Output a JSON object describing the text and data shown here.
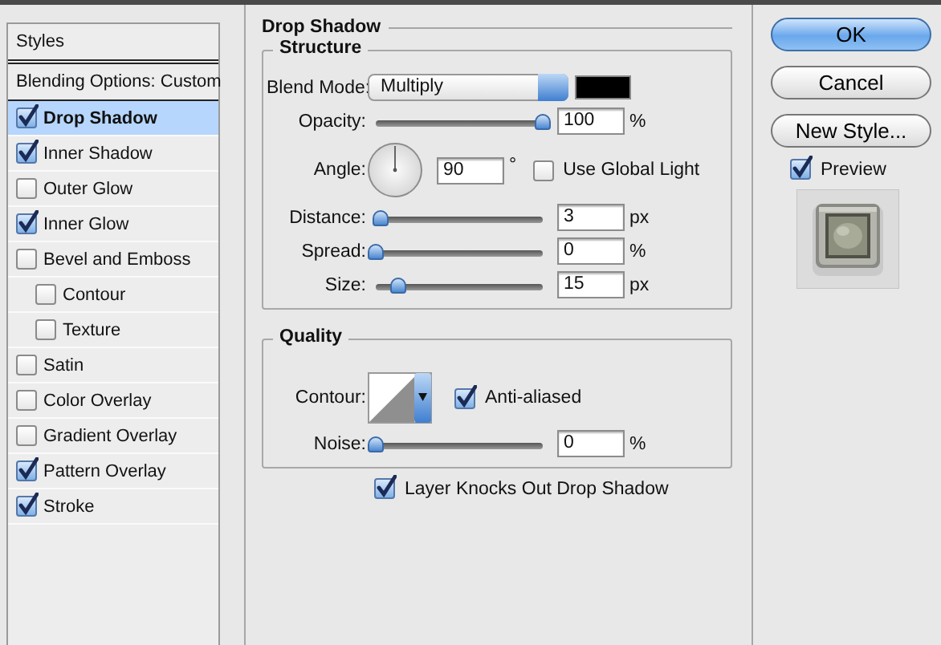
{
  "style_list": {
    "header": "Styles",
    "blending_options": "Blending Options: Custom",
    "items": [
      {
        "label": "Drop Shadow",
        "checked": true,
        "selected": true
      },
      {
        "label": "Inner Shadow",
        "checked": true,
        "selected": false
      },
      {
        "label": "Outer Glow",
        "checked": false,
        "selected": false
      },
      {
        "label": "Inner Glow",
        "checked": true,
        "selected": false
      },
      {
        "label": "Bevel and Emboss",
        "checked": false,
        "selected": false,
        "children": [
          {
            "label": "Contour",
            "checked": false,
            "selected": false
          },
          {
            "label": "Texture",
            "checked": false,
            "selected": false
          }
        ]
      },
      {
        "label": "Satin",
        "checked": false,
        "selected": false
      },
      {
        "label": "Color Overlay",
        "checked": false,
        "selected": false
      },
      {
        "label": "Gradient Overlay",
        "checked": false,
        "selected": false
      },
      {
        "label": "Pattern Overlay",
        "checked": true,
        "selected": false
      },
      {
        "label": "Stroke",
        "checked": true,
        "selected": false
      }
    ]
  },
  "panel": {
    "title": "Drop Shadow",
    "structure": {
      "title": "Structure",
      "rows": [
        {
          "kind": "select",
          "label": "Blend Mode:",
          "value": "Multiply",
          "color": "#000000"
        },
        {
          "kind": "slider",
          "label": "Opacity:",
          "level": 1,
          "value": "100",
          "unit": "%"
        },
        {
          "kind": "angle",
          "label": "Angle:",
          "value": "90",
          "unit": "°",
          "checkbox": {
            "label": "Use Global Light",
            "checked": false
          }
        },
        {
          "kind": "slider",
          "label": "Distance:",
          "level": 0.03,
          "value": "3",
          "unit": "px"
        },
        {
          "kind": "slider",
          "label": "Spread:",
          "level": 0,
          "value": "0",
          "unit": "%"
        },
        {
          "kind": "slider",
          "label": "Size:",
          "level": 0.13,
          "value": "15",
          "unit": "px"
        }
      ]
    },
    "quality": {
      "title": "Quality",
      "rows": [
        {
          "kind": "contour",
          "label": "Contour:",
          "checkbox": {
            "label": "Anti-aliased",
            "checked": true
          }
        },
        {
          "kind": "slider",
          "label": "Noise:",
          "level": 0,
          "value": "0",
          "unit": "%"
        }
      ]
    },
    "knockout": {
      "label": "Layer Knocks Out Drop Shadow",
      "checked": true
    }
  },
  "buttons": [
    {
      "label": "OK",
      "default": true
    },
    {
      "label": "Cancel",
      "default": false
    },
    {
      "label": "New Style...",
      "default": false
    }
  ],
  "preview": {
    "label": "Preview",
    "checked": true
  }
}
